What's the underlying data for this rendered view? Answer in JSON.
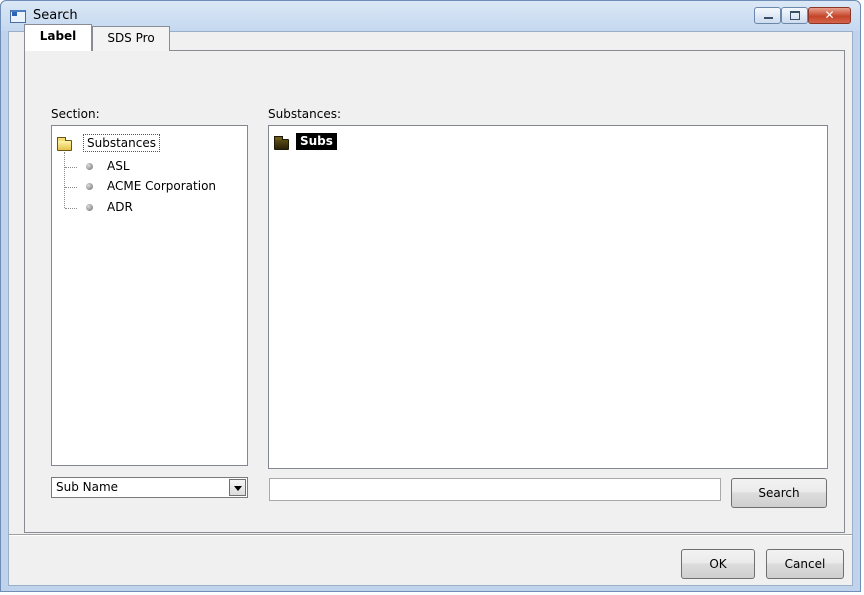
{
  "window": {
    "title": "Search",
    "icon": "application-window-icon",
    "controls": [
      "minimize",
      "maximize",
      "close"
    ]
  },
  "tabs": [
    {
      "label": "Label",
      "active": true
    },
    {
      "label": "SDS Pro",
      "active": false
    }
  ],
  "section_panel": {
    "label": "Section:",
    "tree": {
      "root": {
        "label": "Substances",
        "icon": "open-folder-icon",
        "expanded": true
      },
      "children": [
        {
          "label": "ASL",
          "icon": "bullet-icon"
        },
        {
          "label": "ACME Corporation",
          "icon": "bullet-icon"
        },
        {
          "label": "ADR",
          "icon": "bullet-icon"
        }
      ]
    },
    "field_select": {
      "selected": "Sub Name"
    }
  },
  "substances_panel": {
    "label": "Substances:",
    "items": [
      {
        "label": "Subs",
        "icon": "folder-icon",
        "selected": true
      }
    ],
    "search_input": {
      "value": ""
    },
    "search_button": "Search"
  },
  "footer": {
    "ok": "OK",
    "cancel": "Cancel"
  },
  "colors": {
    "frame": "#bfd4ec",
    "dialog_bg": "#f0f0f0",
    "selection_bg": "#000000",
    "close_button": "#c5452a"
  }
}
